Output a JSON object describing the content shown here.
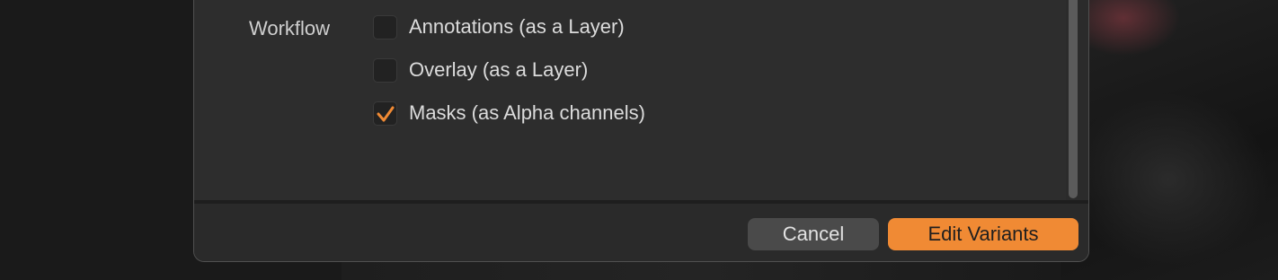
{
  "settings": {
    "section_label": "Workflow",
    "options": [
      {
        "label": "Annotations (as a Layer)",
        "checked": false
      },
      {
        "label": "Overlay (as a Layer)",
        "checked": false
      },
      {
        "label": "Masks (as Alpha channels)",
        "checked": true
      }
    ]
  },
  "footer": {
    "cancel_label": "Cancel",
    "primary_label": "Edit Variants"
  },
  "colors": {
    "accent": "#f08a34",
    "dialog_bg": "#2b2b2b",
    "checkmark": "#f08a34"
  }
}
